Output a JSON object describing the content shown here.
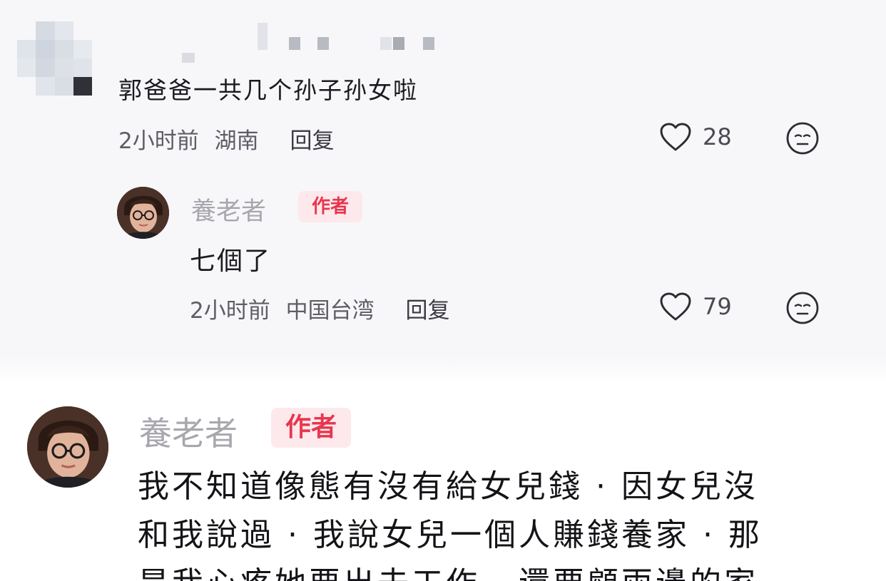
{
  "comment": {
    "text": "郭爸爸一共几个孙子孙女啦",
    "time": "2小时前",
    "location": "湖南",
    "reply_label": "回复",
    "likes": "28"
  },
  "reply": {
    "author": "養老者",
    "badge": "作者",
    "text": "七個了",
    "time": "2小时前",
    "location": "中国台湾",
    "reply_label": "回复",
    "likes": "79"
  },
  "author_comment": {
    "author": "養老者",
    "badge": "作者",
    "lines": [
      "我不知道像態有沒有給女兒錢 · 因女兒沒",
      "和我說過 · 我說女兒一個人賺錢養家 · 那",
      "是我心疼她要出去工作 · 還要顧兩邊的家"
    ]
  },
  "colors": {
    "badge_text": "#e8364f",
    "badge_bg": "#fde9ec"
  },
  "icons": {
    "like": "heart-outline-icon",
    "emoji": "neutral-face-icon"
  }
}
